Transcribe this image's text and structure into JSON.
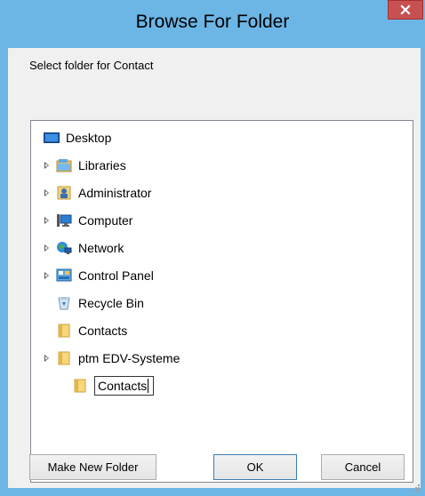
{
  "dialog": {
    "title": "Browse For Folder",
    "prompt": "Select folder for Contact",
    "close_glyph": "x"
  },
  "tree": {
    "items": [
      {
        "label": "Desktop",
        "icon": "desktop-icon",
        "expandable": false
      },
      {
        "label": "Libraries",
        "icon": "libraries-icon",
        "expandable": true
      },
      {
        "label": "Administrator",
        "icon": "user-folder-icon",
        "expandable": true
      },
      {
        "label": "Computer",
        "icon": "computer-icon",
        "expandable": true
      },
      {
        "label": "Network",
        "icon": "network-icon",
        "expandable": true
      },
      {
        "label": "Control Panel",
        "icon": "control-panel-icon",
        "expandable": true
      },
      {
        "label": "Recycle Bin",
        "icon": "recycle-bin-icon",
        "expandable": false
      },
      {
        "label": "Contacts",
        "icon": "folder-icon",
        "expandable": false
      },
      {
        "label": "ptm EDV-Systeme",
        "icon": "folder-icon",
        "expandable": true
      }
    ],
    "editing": {
      "value": "Contacts",
      "icon": "folder-icon"
    }
  },
  "buttons": {
    "make_new_folder": "Make New Folder",
    "ok": "OK",
    "cancel": "Cancel"
  }
}
